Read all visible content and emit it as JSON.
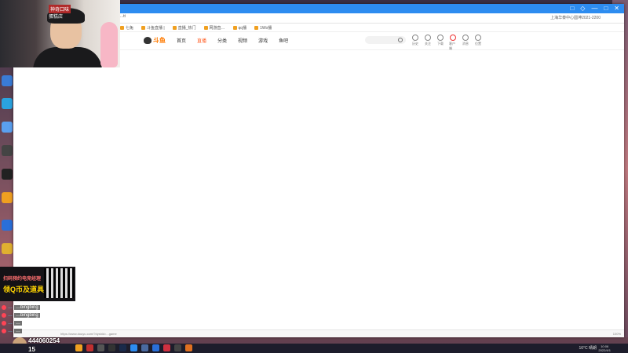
{
  "browser": {
    "address_text": "...tt",
    "addr_right": [
      "上海华泰中心圆坤2021-2200"
    ],
    "bookmarks": [
      "七兔",
      "斗鱼直播 |",
      "直播_热门",
      "网游直…",
      "qq播",
      "1Wo播"
    ],
    "window_controls": [
      "□",
      "◇",
      "—",
      "□",
      "✕"
    ]
  },
  "site": {
    "logo_text": "斗鱼",
    "nav": [
      "首页",
      "直播",
      "分类",
      "视频",
      "游戏",
      "鱼吧"
    ],
    "nav_active_index": 1,
    "header_icons": [
      "历史",
      "关注",
      "下载",
      "客户端",
      "消息",
      "位置"
    ]
  },
  "status_bar": {
    "url": "https://www.douyu.com/?dyshid=...game",
    "zoom": "100%"
  },
  "webcam": {
    "sign_top": "神奇口味",
    "sign_bottom": "蛋糕店"
  },
  "promo": {
    "line1": "扫码预约电竞经理",
    "line2": "领Q币及道具"
  },
  "chat": [
    {
      "name": "…",
      "msg": "…bingbing"
    },
    {
      "name": "…",
      "msg": "…bingbing"
    },
    {
      "name": "…",
      "msg": "…"
    },
    {
      "name": "…",
      "msg": "…"
    }
  ],
  "overlay": {
    "viewer_line1": "444060254",
    "viewer_line2": "15"
  },
  "taskbar": {
    "weather": "16°C 晴朗",
    "time": "10:06",
    "date": "2022/4/1"
  }
}
